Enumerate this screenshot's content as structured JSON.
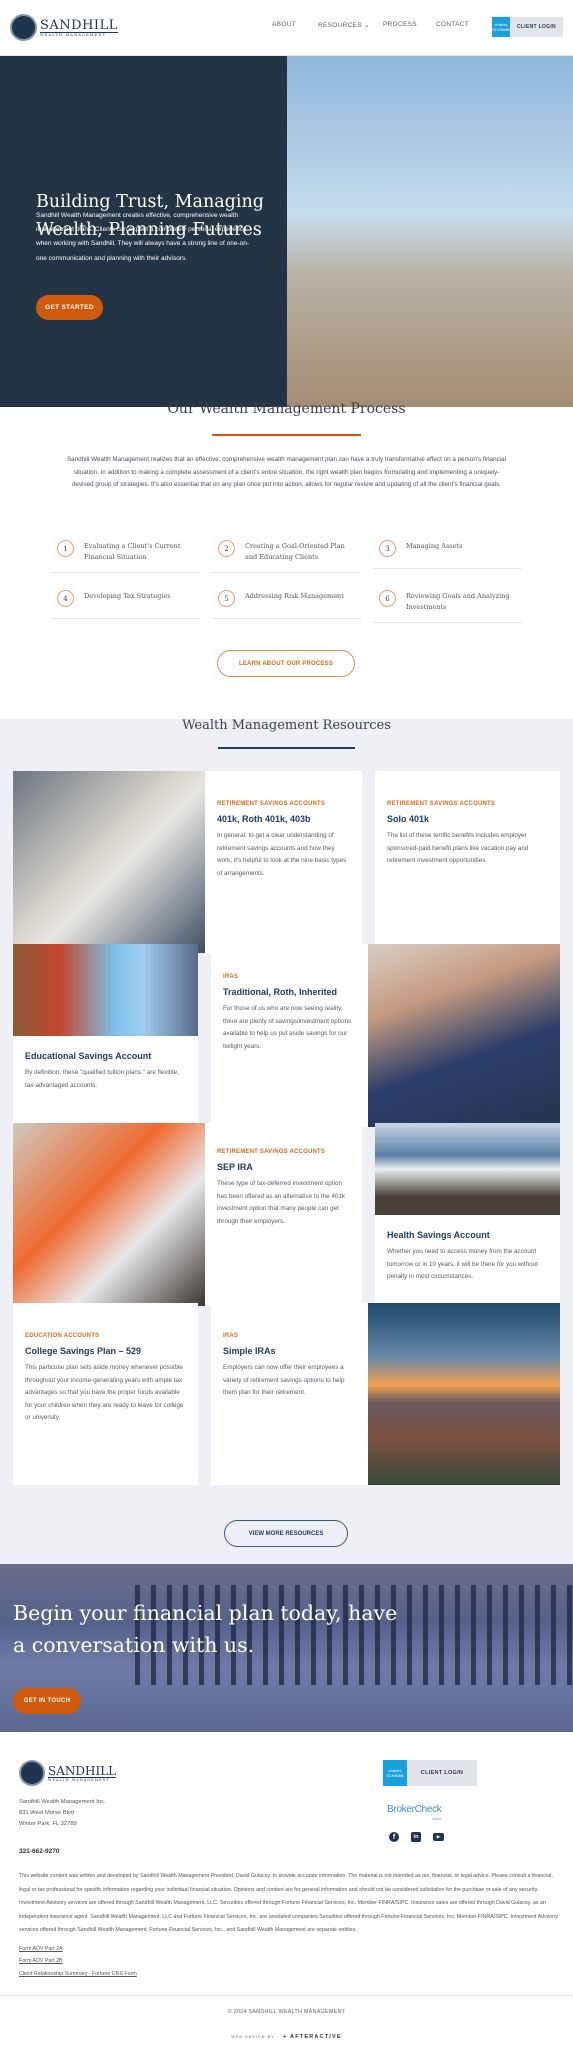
{
  "header": {
    "logo_name": "SANDHILL",
    "logo_sub": "WEALTH MANAGEMENT",
    "nav": [
      {
        "label": "ABOUT"
      },
      {
        "label": "RESOURCES ⌄"
      },
      {
        "label": "PROCESS"
      },
      {
        "label": "CONTACT"
      }
    ],
    "client_login": {
      "badge": "charles SCHWAB",
      "label": "CLIENT LOGIN"
    }
  },
  "hero": {
    "title_line1": "Building Trust, Managing",
    "title_line2": "Wealth, Planning Futures",
    "body": "Sandhill Wealth Management creates effective, comprehensive wealth management plans. Clients can expect a completely personal experience when working with Sandhill. They will always have a strong line of one-on-one communication and planning with their advisors.",
    "cta": "GET STARTED"
  },
  "process": {
    "title": "Our Wealth Management Process",
    "body": "Sandhill Wealth Management realizes that an effective, comprehensive wealth management plan can have a truly transformative effect on a person's financial situation. In addition to making a complete assessment of a client's entire situation, the right wealth plan begins formulating and implementing a uniquely-devised group of strategies. It's also essential that on any plan once put into action, allows for regular review and updating of all the client's financial goals.",
    "steps": [
      {
        "n": "1",
        "label": "Evaluating a Client's Current Financial Situation"
      },
      {
        "n": "2",
        "label": "Creating a Goal-Oriented Plan and Educating Clients"
      },
      {
        "n": "3",
        "label": "Managing Assets"
      },
      {
        "n": "4",
        "label": "Developing Tax Strategies"
      },
      {
        "n": "5",
        "label": "Addressing Risk Management"
      },
      {
        "n": "6",
        "label": "Reviewing Goals and Analyzing Investments"
      }
    ],
    "cta": "LEARN ABOUT OUR PROCESS"
  },
  "resources": {
    "title": "Wealth Management Resources",
    "cards": [
      {
        "category": "RETIREMENT SAVINGS ACCOUNTS",
        "title": "401k, Roth 401k, 403b",
        "body": "In general, to get a clear understanding of retirement savings accounts and how they work, it's helpful to look at the nine basic types of arrangements."
      },
      {
        "category": "RETIREMENT SAVINGS ACCOUNTS",
        "title": "Solo 401k",
        "body": "The list of these terrific benefits includes employer sponsored-paid benefit plans like vacation pay and retirement investment opportunities."
      },
      {
        "category": "",
        "title": "Educational Savings Account",
        "body": "By definition, these \"qualified tuition plans,\" are flexible, tax-advantaged accounts."
      },
      {
        "category": "IRAS",
        "title": "Traditional, Roth, Inherited",
        "body": "For those of us who are now seeing reality, there are plenty of savings/investment options available to help us put aside savings for our twilight years."
      },
      {
        "category": "RETIREMENT SAVINGS ACCOUNTS",
        "title": "SEP IRA",
        "body": "These type of tax-deferred investment option has been offered as an alternative to the 401k investment option that many people can get through their employers."
      },
      {
        "category": "",
        "title": "Health Savings Account",
        "body": "Whether you need to access money from the account tomorrow or in 10 years, it will be there for you without penalty in most circumstances."
      },
      {
        "category": "EDUCATION ACCOUNTS",
        "title": "College Savings Plan – 529",
        "body": "This particular plan sets aside money whenever possible throughout your income-generating years with ample tax advantages so that you have the proper funds available for your children when they are ready to leave for college or university."
      },
      {
        "category": "IRAS",
        "title": "Simple IRAs",
        "body": "Employers can now offer their employees a variety of retirement savings options to help them plan for their retirement."
      }
    ],
    "cta": "VIEW MORE RESOURCES"
  },
  "cta_band": {
    "title_line1": "Begin your financial plan today, have",
    "title_line2": "a conversation with us.",
    "button": "GET IN TOUCH"
  },
  "footer": {
    "company": "Sandhill Wealth Management Inc.",
    "address1": "831 West Morse Blvd",
    "address2": "Winter Park, FL 32789",
    "phone": "321-662-9270",
    "client_login": "CLIENT LOGIN",
    "brokercheck": "BrokerCheck",
    "brokercheck_sub": "FINRA",
    "social": [
      "facebook",
      "linkedin",
      "youtube"
    ],
    "disclaimer": "This website content was written and developed by Sandhill Wealth Management President, David Gulacsy, to provide accurate information. The material is not intended as tax, financial, or legal advice. Please consult a financial, legal or tax professional for specific information regarding your individual financial situation. Opinions and content are for general information and should not be considered solicitation for the purchase or sale of any security. Investment Advisory services are offered through Sandhill Wealth Management, LLC. Securities offered through Fortune Financial Services, Inc. Member FINRA/SIPC. Insurance sales are offered through David Gulacsy, as an independent insurance agent. Sandhill Wealth Management, LLC and Fortune Financial Services, Inc. are unrelated companies.Securities offered through Fortune Financial Services, Inc. Member FINRA/SIPC. Investment Advisory services offered through Sandhill Wealth Management. Fortune Financial Services, Inc., and Sandhill Wealth Management are separate entities.",
    "links": [
      "Form ADV Part 2A",
      "Form ADV Part 2B",
      "Client Relationship Summary - Fortune CRS Form"
    ],
    "copyright": "© 2024 SANDHILL WEALTH MANAGEMENT",
    "webdesign_prefix": "WEB DESIGN BY",
    "webdesign_brand": "+ AFTERACTIVE"
  },
  "colors": {
    "navy": "#233444",
    "accent": "#cf5a0c",
    "heading_blue": "#1f3d63",
    "resources_bg": "#eef0f5"
  }
}
